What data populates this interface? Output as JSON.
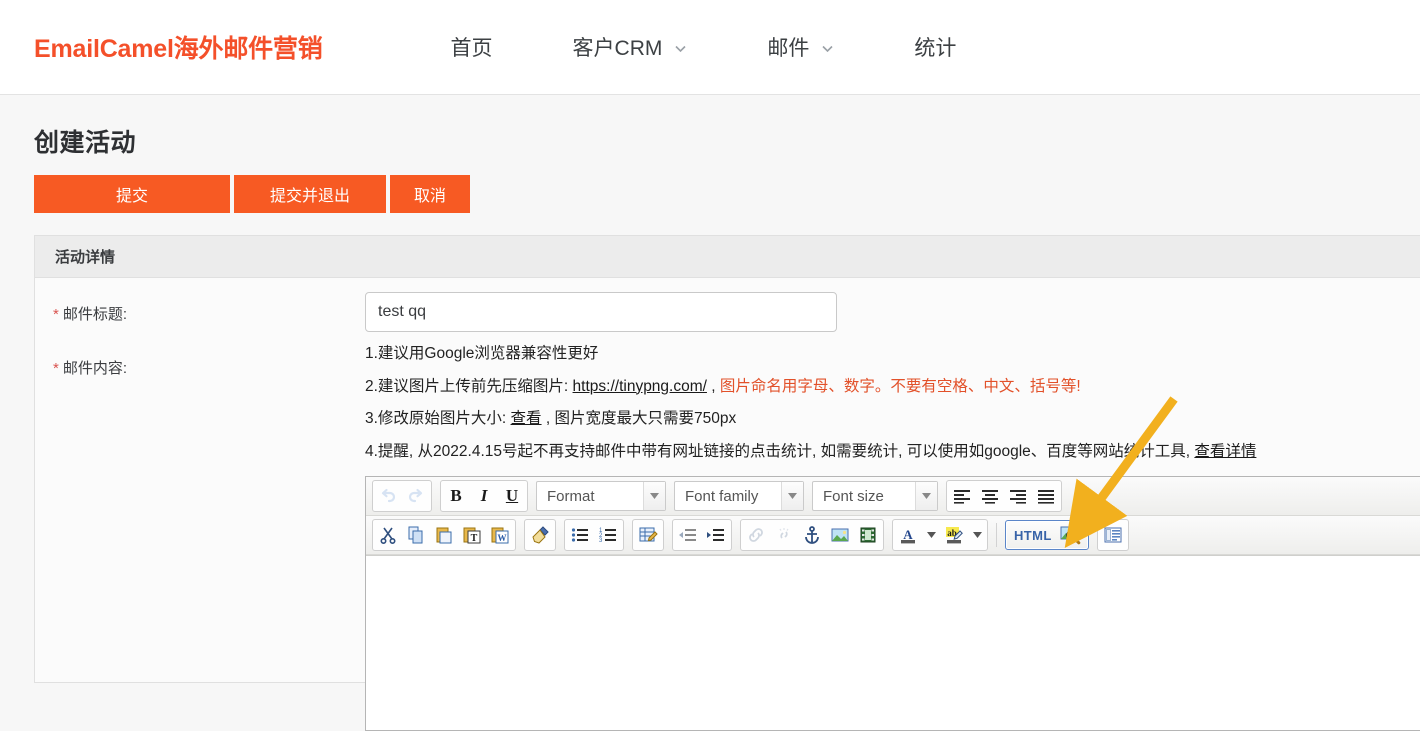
{
  "brand": {
    "text": "EmailCamel海外邮件营销",
    "color": "#f4502a"
  },
  "nav": {
    "items": [
      {
        "label": "首页",
        "has_caret": false,
        "icon": ""
      },
      {
        "label": "客户CRM",
        "has_caret": true,
        "icon": "chevron-down-icon"
      },
      {
        "label": "邮件",
        "has_caret": true,
        "icon": "chevron-down-icon"
      },
      {
        "label": "统计",
        "has_caret": false,
        "icon": ""
      }
    ]
  },
  "page": {
    "title": "创建活动",
    "buttons": {
      "submit": "提交",
      "submit_exit": "提交并退出",
      "cancel": "取消"
    },
    "accent_color": "#f75a23"
  },
  "panel": {
    "header": "活动详情",
    "fields": {
      "subject": {
        "required_mark": "*",
        "label": "邮件标题:",
        "value": "test qq",
        "placeholder": ""
      },
      "content": {
        "required_mark": "*",
        "label": "邮件内容:"
      }
    },
    "tips": {
      "tip1": "1.建议用Google浏览器兼容性更好",
      "tip2_prefix": "2.建议图片上传前先压缩图片: ",
      "tip2_link": "https://tinypng.com/",
      "tip2_comma": " , ",
      "tip2_warn": "图片命名用字母、数字。不要有空格、中文、括号等!",
      "tip3_prefix": "3.修改原始图片大小: ",
      "tip3_link": "查看",
      "tip3_suffix": " , 图片宽度最大只需要750px",
      "tip4_prefix": "4.提醒, 从2022.4.15号起不再支持邮件中带有网址链接的点击统计, 如需要统计, 可以使用如google、百度等网站统计工具, ",
      "tip4_link": "查看详情"
    }
  },
  "editor": {
    "row1": {
      "undo": {
        "name": "undo-icon",
        "disabled": true
      },
      "redo": {
        "name": "redo-icon",
        "disabled": true
      },
      "bold": "B",
      "italic": "I",
      "underline": "U",
      "format_select": {
        "value": "Format"
      },
      "fontfamily_select": {
        "value": "Font family"
      },
      "fontsize_select": {
        "value": "Font size"
      },
      "align": [
        "align-left-icon",
        "align-center-icon",
        "align-right-icon",
        "align-justify-icon"
      ]
    },
    "row2": {
      "clipboard": [
        "cut-icon",
        "copy-icon",
        "paste-icon",
        "paste-text-icon",
        "paste-word-icon"
      ],
      "cleanup": [
        "remove-format-icon"
      ],
      "lists": [
        "bullet-list-icon",
        "numbered-list-icon"
      ],
      "table": [
        "edit-table-icon"
      ],
      "indent": [
        "outdent-icon",
        "indent-icon"
      ],
      "insert": [
        "link-icon",
        "unlink-icon",
        "anchor-icon",
        "image-icon",
        "media-icon"
      ],
      "color": [
        "text-color-icon",
        "background-color-icon"
      ],
      "html_button": {
        "label": "HTML",
        "icon": "preview-icon",
        "highlighted": true
      },
      "template": [
        "template-icon"
      ]
    },
    "body_text": ""
  },
  "annotation": {
    "arrow_color": "#f2b01e",
    "points_at": "HTML"
  }
}
